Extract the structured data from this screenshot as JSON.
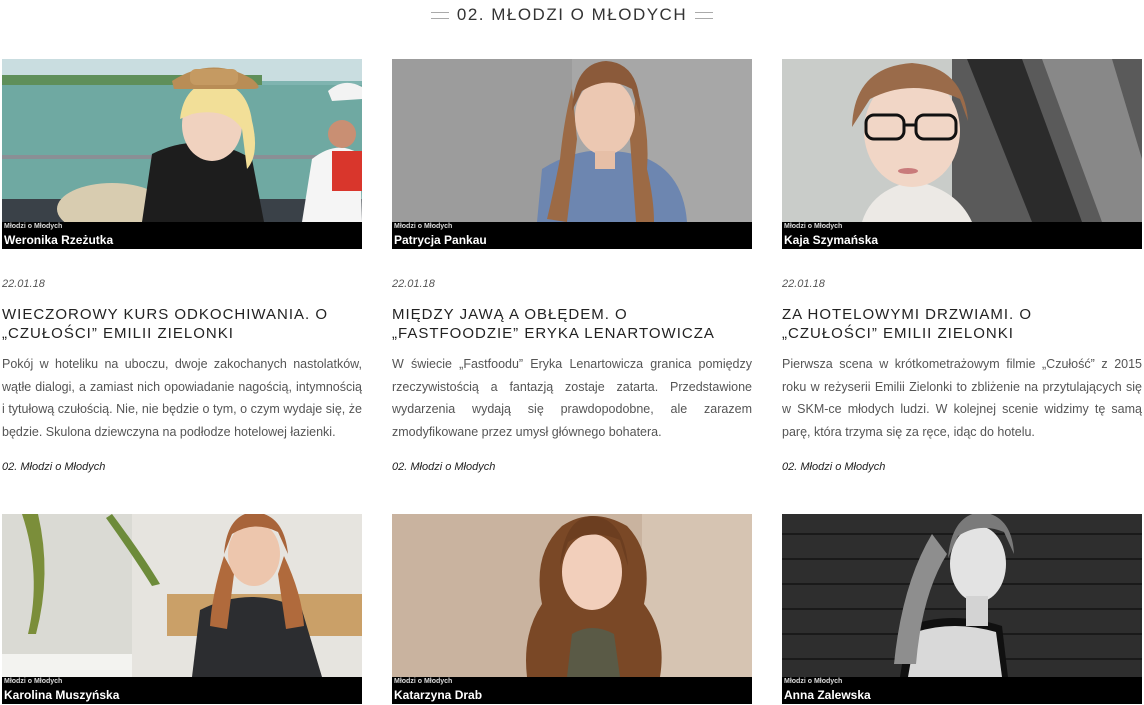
{
  "section": {
    "title": "02. MŁODZI O MŁODYCH"
  },
  "cards": [
    {
      "category": "Młodzi o Młodych",
      "name": "Weronika Rzeżutka",
      "date": "22.01.18",
      "title": "WIECZOROWY KURS ODKOCHIWANIA. O „CZUŁOŚCI” EMILII ZIELONKI",
      "excerpt": "Pokój w hoteliku na uboczu, dwoje zakochanych nastolatków, wątłe dialogi, a zamiast nich opowiadanie nagością, intymnością i tytułową czułością. Nie, nie będzie o tym, o czym wydaje się, że będzie. Skulona dziewczyna na podłodze hotelowej łazienki.",
      "tag": "02. Młodzi o Młodych"
    },
    {
      "category": "Młodzi o Młodych",
      "name": "Patrycja Pankau",
      "date": "22.01.18",
      "title": "MIĘDZY JAWĄ A OBŁĘDEM. O „FASTFOODZIE” ERYKA LENARTOWICZA",
      "excerpt": "W świecie „Fastfoodu” Eryka Lenartowicza granica pomiędzy rzeczywistością a fantazją zostaje zatarta. Przedstawione wydarzenia wydają się prawdopodobne, ale zarazem zmodyfikowane przez umysł głównego bohatera.",
      "tag": "02. Młodzi o Młodych"
    },
    {
      "category": "Młodzi o Młodych",
      "name": "Kaja Szymańska",
      "date": "22.01.18",
      "title": "ZA HOTELOWYMI DRZWIAMI. O „CZUŁOŚCI” EMILII ZIELONKI",
      "excerpt": "Pierwsza scena w krótkometrażowym filmie „Czułość” z 2015 roku w reżyserii Emilii Zielonki to zbliżenie na przytulających się w SKM-ce młodych ludzi. W kolejnej scenie widzimy tę samą parę, która trzyma się za ręce, idąc do hotelu.",
      "tag": "02. Młodzi o Młodych"
    },
    {
      "category": "Młodzi o Młodych",
      "name": "Karolina Muszyńska"
    },
    {
      "category": "Młodzi o Młodych",
      "name": "Katarzyna Drab"
    },
    {
      "category": "Młodzi o Młodych",
      "name": "Anna Zalewska"
    }
  ]
}
